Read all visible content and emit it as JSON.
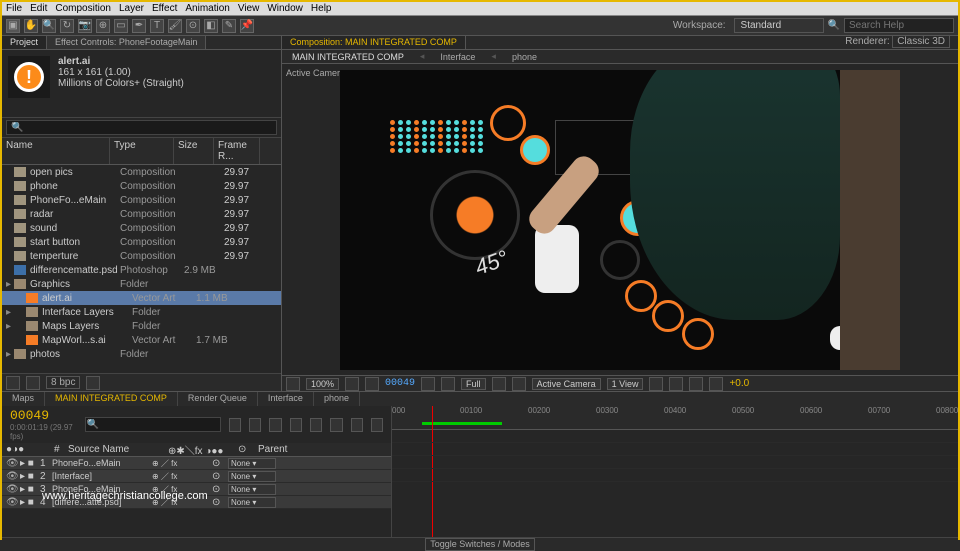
{
  "menu": [
    "File",
    "Edit",
    "Composition",
    "Layer",
    "Effect",
    "Animation",
    "View",
    "Window",
    "Help"
  ],
  "workspace": {
    "label": "Workspace:",
    "value": "Standard"
  },
  "search_help": "Search Help",
  "left": {
    "tabs": {
      "project": "Project",
      "effects": "Effect Controls: PhoneFootageMain"
    },
    "asset": {
      "name": "alert.ai",
      "dims": "161 x 161 (1.00)",
      "colors": "Millions of Colors+ (Straight)"
    },
    "headers": {
      "name": "Name",
      "type": "Type",
      "size": "Size",
      "fr": "Frame R..."
    },
    "rows": [
      {
        "name": "open pics",
        "type": "Composition",
        "fr": "29.97"
      },
      {
        "name": "phone",
        "type": "Composition",
        "fr": "29.97"
      },
      {
        "name": "PhoneFo...eMain",
        "type": "Composition",
        "fr": "29.97"
      },
      {
        "name": "radar",
        "type": "Composition",
        "fr": "29.97"
      },
      {
        "name": "sound",
        "type": "Composition",
        "fr": "29.97"
      },
      {
        "name": "start button",
        "type": "Composition",
        "fr": "29.97"
      },
      {
        "name": "temperture",
        "type": "Composition",
        "fr": "29.97"
      },
      {
        "name": "differencematte.psd",
        "type": "Photoshop",
        "size": "2.9 MB",
        "icon": "psd"
      },
      {
        "name": "Graphics",
        "type": "Folder",
        "icon": "folder",
        "arrow": true
      },
      {
        "name": "alert.ai",
        "type": "Vector Art",
        "size": "1.1 MB",
        "icon": "ai",
        "sel": true,
        "indent": true
      },
      {
        "name": "Interface Layers",
        "type": "Folder",
        "icon": "folder",
        "arrow": true,
        "indent": true
      },
      {
        "name": "Maps Layers",
        "type": "Folder",
        "icon": "folder",
        "arrow": true,
        "indent": true
      },
      {
        "name": "MapWorl...s.ai",
        "type": "Vector Art",
        "size": "1.7 MB",
        "icon": "ai",
        "indent": true
      },
      {
        "name": "photos",
        "type": "Folder",
        "icon": "folder",
        "arrow": true
      }
    ],
    "bpc": "8 bpc"
  },
  "comp": {
    "tab": "Composition: MAIN INTEGRATED COMP",
    "renderer": "Renderer:",
    "renderer_val": "Classic 3D",
    "crumbs": [
      "MAIN INTEGRATED COMP",
      "Interface",
      "phone"
    ],
    "viewer_label": "Active Camera",
    "footer": {
      "zoom": "100%",
      "res": "Full",
      "camera": "Active Camera",
      "views": "1 View",
      "time": "00049",
      "exp": "+0.0"
    }
  },
  "timeline": {
    "tabs": [
      "Maps",
      "MAIN INTEGRATED COMP",
      "Render Queue",
      "Interface",
      "phone"
    ],
    "timecode": "00049",
    "timecode_sub": "0:00:01:19 (29.97 fps)",
    "header": {
      "src": "Source Name",
      "parent": "Parent"
    },
    "layers": [
      {
        "n": "1",
        "name": "PhoneFo...eMain",
        "parent": "None"
      },
      {
        "n": "2",
        "name": "[Interface]",
        "parent": "None"
      },
      {
        "n": "3",
        "name": "PhoneFo...eMain",
        "parent": "None"
      },
      {
        "n": "4",
        "name": "[differe...atte.psd]",
        "parent": "None"
      }
    ],
    "ticks": [
      "000",
      "00100",
      "00200",
      "00300",
      "00400",
      "00500",
      "00600",
      "00700",
      "00800"
    ],
    "toggle": "Toggle Switches / Modes"
  },
  "watermark": "www.heritagechristiancollege.com"
}
